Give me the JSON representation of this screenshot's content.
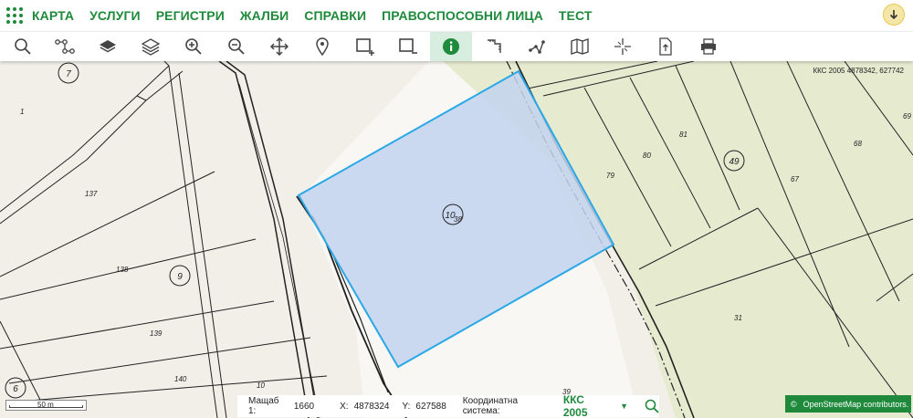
{
  "nav": {
    "items": [
      "КАРТА",
      "УСЛУГИ",
      "РЕГИСТРИ",
      "ЖАЛБИ",
      "СПРАВКИ",
      "ПРАВОСПОСОБНИ ЛИЦА",
      "ТЕСТ"
    ]
  },
  "toolbar": {
    "tools": [
      {
        "icon": "search-icon",
        "active": false
      },
      {
        "icon": "network-icon",
        "active": false
      },
      {
        "icon": "layers-filled-icon",
        "active": false
      },
      {
        "icon": "layers-outline-icon",
        "active": false
      },
      {
        "icon": "zoom-in-icon",
        "active": false
      },
      {
        "icon": "zoom-out-icon",
        "active": false
      },
      {
        "icon": "pan-icon",
        "active": false
      },
      {
        "icon": "location-pin-icon",
        "active": false
      },
      {
        "icon": "select-add-icon",
        "active": false
      },
      {
        "icon": "select-remove-icon",
        "active": false
      },
      {
        "icon": "info-icon",
        "active": true
      },
      {
        "icon": "measure-distance-icon",
        "active": false
      },
      {
        "icon": "measure-polygon-icon",
        "active": false
      },
      {
        "icon": "map-icon",
        "active": false
      },
      {
        "icon": "crosshair-icon",
        "active": false
      },
      {
        "icon": "export-icon",
        "active": false
      },
      {
        "icon": "print-icon",
        "active": false
      }
    ]
  },
  "map": {
    "coords_readout": "ККС 2005 4878342, 627742",
    "circle_labels": [
      "7",
      "9",
      "6",
      "10",
      "49"
    ],
    "parcel_labels": [
      "1",
      "137",
      "138",
      "139",
      "140",
      "10",
      "38",
      "79",
      "80",
      "81",
      "67",
      "68",
      "69",
      "31",
      "39"
    ],
    "selection_fill": "#c3d3ee",
    "selection_stroke": "#2aa7e6",
    "agri_area_color": "#e6ebd0"
  },
  "scale_bar": {
    "label": "50 m"
  },
  "status": {
    "scale_label": "Мащаб 1:",
    "scale_value": "1660",
    "x_label": "X:",
    "x_value": "4878324",
    "y_label": "Y:",
    "y_value": "627588",
    "crs_label": "Координатна система:",
    "crs_value": "ККС 2005"
  },
  "attribution": {
    "symbol": "©",
    "text": "OpenStreetMap contributors."
  },
  "colors": {
    "accent": "#1f8a3b"
  }
}
